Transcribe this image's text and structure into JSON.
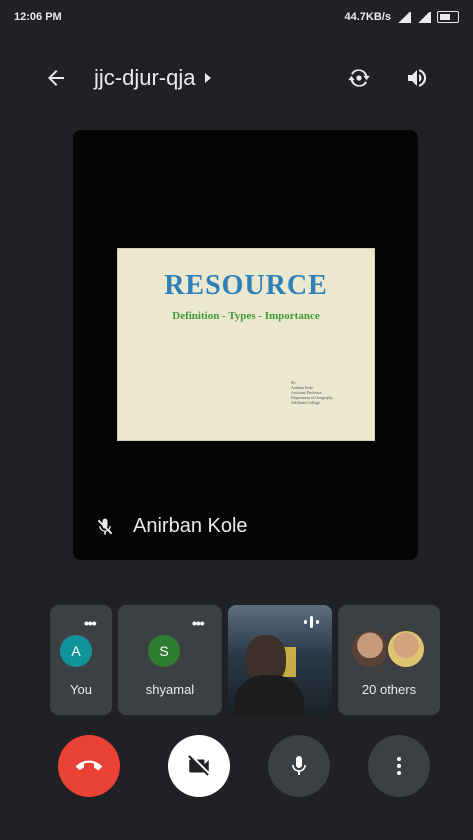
{
  "status_bar": {
    "time": "12:06 PM",
    "speed": "44.7KB/s"
  },
  "top_bar": {
    "meeting_code": "jjc-djur-qja"
  },
  "main_tile": {
    "slide": {
      "title": "RESOURCE",
      "subtitle": "Definition - Types - Importance",
      "credits": [
        "By",
        "Anirban Kole",
        "Assistant Professor",
        "Department of Geography",
        "Affiliated College"
      ]
    },
    "speaker_name": "Anirban Kole"
  },
  "participants": [
    {
      "initial": "A",
      "label": "You",
      "avatar_color": "#12939a"
    },
    {
      "initial": "S",
      "label": "shyamal",
      "avatar_color": "#2e7d32"
    },
    {
      "label": ""
    },
    {
      "label": "20 others"
    }
  ],
  "colors": {
    "end_call": "#ea4335",
    "background": "#202124",
    "tile": "#3c4043"
  },
  "icons": [
    "back-arrow-icon",
    "dropdown-caret-icon",
    "switch-camera-icon",
    "speaker-icon",
    "mic-off-icon",
    "more-dots-icon",
    "end-call-icon",
    "camera-off-icon",
    "microphone-icon",
    "more-vertical-icon"
  ]
}
